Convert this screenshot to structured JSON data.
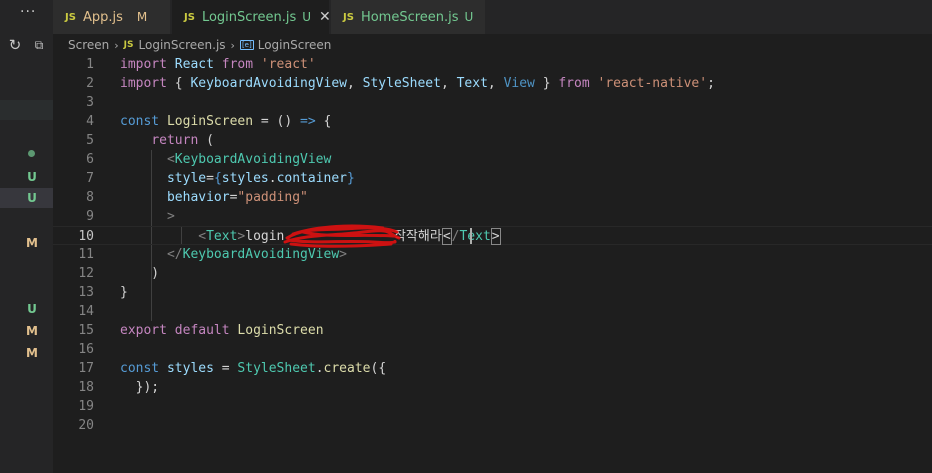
{
  "sidebar": {
    "overflow_label": "···",
    "refresh_icon": "refresh-icon",
    "collapse_icon": "collapse-all-icon",
    "badges": [
      "U",
      "U",
      "M",
      "U",
      "M",
      "M"
    ]
  },
  "tabs": [
    {
      "icon": "JS",
      "label": "App.js",
      "badge": "M",
      "active": false
    },
    {
      "icon": "JS",
      "label": "LoginScreen.js",
      "badge": "U",
      "active": true,
      "close": "✕"
    },
    {
      "icon": "JS",
      "label": "HomeScreen.js",
      "badge": "U",
      "active": false
    }
  ],
  "breadcrumb": {
    "folder": "Screen",
    "file_icon": "JS",
    "file": "LoginScreen.js",
    "symbol": "LoginScreen"
  },
  "editor": {
    "line_numbers": [
      "1",
      "2",
      "3",
      "4",
      "5",
      "6",
      "7",
      "8",
      "9",
      "10",
      "11",
      "12",
      "13",
      "14",
      "15",
      "16",
      "17",
      "18",
      "19",
      "20"
    ],
    "lines": [
      "import React from 'react'",
      "import { KeyboardAvoidingView, StyleSheet, Text, View } from 'react-native';",
      "",
      "const LoginScreen = () => {",
      "    return (",
      "      <KeyboardAvoidingView",
      "      style={styles.container}",
      "      behavior=\"padding\"",
      "      >",
      "          <Text>login [redacted] 작작해라</Text>",
      "      </KeyboardAvoidingView>",
      "    )",
      "}",
      "",
      "export default LoginScreen",
      "",
      "const styles = StyleSheet.create({",
      "  });",
      "",
      ""
    ],
    "visible_line10_start": "login",
    "visible_line10_end": "작작해라",
    "current_line": "10"
  }
}
